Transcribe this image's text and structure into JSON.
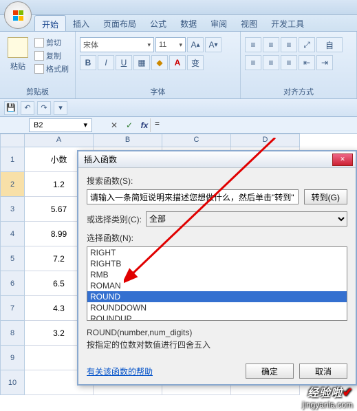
{
  "tabs": {
    "t0": "开始",
    "t1": "插入",
    "t2": "页面布局",
    "t3": "公式",
    "t4": "数据",
    "t5": "审阅",
    "t6": "视图",
    "t7": "开发工具"
  },
  "clipboard": {
    "paste": "粘贴",
    "cut": "剪切",
    "copy": "复制",
    "fmt": "格式刷",
    "label": "剪贴板"
  },
  "font": {
    "name": "宋体",
    "size": "11",
    "label": "字体"
  },
  "align": {
    "label": "对齐方式",
    "wrap": "自"
  },
  "namebox": "B2",
  "formula": "=",
  "col": {
    "a": "A",
    "b": "B",
    "c": "C",
    "d": "D"
  },
  "rows": {
    "r1": "1",
    "r2": "2",
    "r3": "3",
    "r4": "4",
    "r5": "5",
    "r6": "6",
    "r7": "7",
    "r8": "8",
    "r9": "9",
    "r10": "10"
  },
  "cells": {
    "a1": "小数",
    "a2": "1.2",
    "a3": "5.67",
    "a4": "8.99",
    "a5": "7.2",
    "a6": "6.5",
    "a7": "4.3",
    "a8": "3.2"
  },
  "dialog": {
    "title": "插入函数",
    "searchLabel": "搜索函数(S):",
    "searchPH": "请输入一条简短说明来描述您想做什么，然后单击\"转到\"",
    "go": "转到(G)",
    "catLabel": "或选择类别(C):",
    "catValue": "全部",
    "selLabel": "选择函数(N):",
    "fns": {
      "f0": "RIGHT",
      "f1": "RIGHTB",
      "f2": "RMB",
      "f3": "ROMAN",
      "f4": "ROUND",
      "f5": "ROUNDDOWN",
      "f6": "ROUNDUP"
    },
    "sig": "ROUND(number,num_digits)",
    "desc": "按指定的位数对数值进行四舍五入",
    "help": "有关该函数的帮助",
    "ok": "确定",
    "cancel": "取消"
  },
  "watermark": {
    "brand": "经验啦",
    "url": "jingyanla.com"
  }
}
